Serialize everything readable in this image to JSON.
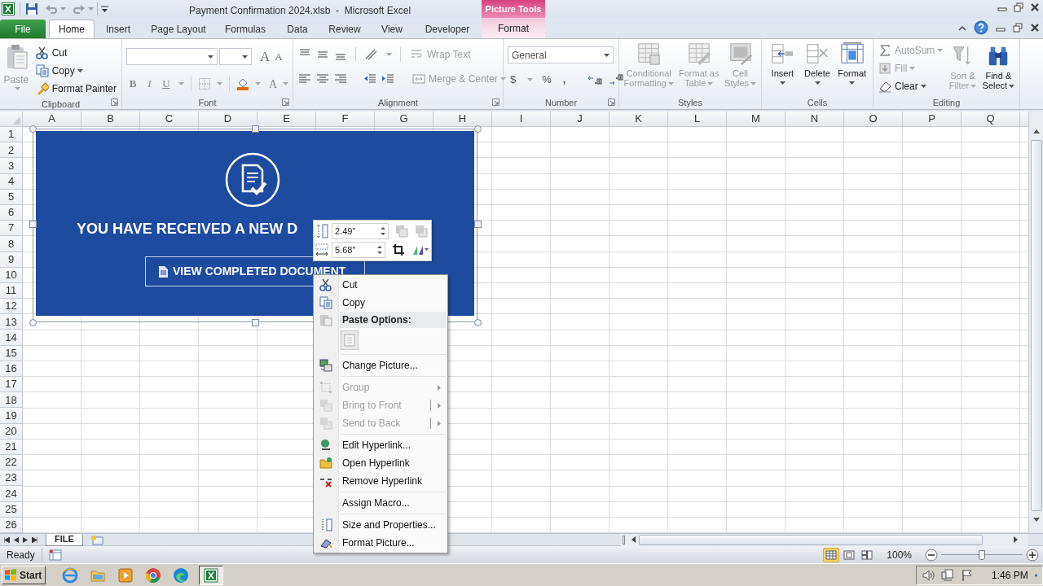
{
  "window": {
    "title": "Payment Confirmation 2024.xlsb  -  Microsoft Excel",
    "contextual_group": "Picture Tools"
  },
  "tabs": [
    {
      "label": "File",
      "kind": "file",
      "selected": false
    },
    {
      "label": "Home",
      "kind": "normal",
      "selected": true
    },
    {
      "label": "Insert",
      "kind": "normal",
      "selected": false
    },
    {
      "label": "Page Layout",
      "kind": "normal",
      "selected": false
    },
    {
      "label": "Formulas",
      "kind": "normal",
      "selected": false
    },
    {
      "label": "Data",
      "kind": "normal",
      "selected": false
    },
    {
      "label": "Review",
      "kind": "normal",
      "selected": false
    },
    {
      "label": "View",
      "kind": "normal",
      "selected": false
    },
    {
      "label": "Developer",
      "kind": "normal",
      "selected": false
    },
    {
      "label": "Format",
      "kind": "contextual",
      "selected": false
    }
  ],
  "ribbon": {
    "clipboard": {
      "label": "Clipboard",
      "paste": {
        "label": "Paste",
        "disabled": true
      },
      "cut": "Cut",
      "copy": "Copy",
      "format_painter": "Format Painter"
    },
    "font": {
      "label": "Font",
      "grow": "A",
      "shrink": "A",
      "bold": "B",
      "italic": "I",
      "underline": "U",
      "font_color_button": "A"
    },
    "alignment": {
      "label": "Alignment",
      "wrap_text": {
        "label": "Wrap Text",
        "disabled": true
      },
      "merge_center": {
        "label": "Merge & Center",
        "disabled": true
      }
    },
    "number": {
      "label": "Number",
      "format": "General",
      "currency": "$",
      "percent": "%",
      "comma": ","
    },
    "styles": {
      "label": "Styles",
      "buttons": [
        {
          "label": "Conditional Formatting",
          "disabled": true
        },
        {
          "label": "Format as Table",
          "disabled": true
        },
        {
          "label": "Cell Styles",
          "disabled": true
        }
      ]
    },
    "cells": {
      "label": "Cells",
      "buttons": [
        {
          "label": "Insert"
        },
        {
          "label": "Delete"
        },
        {
          "label": "Format"
        }
      ]
    },
    "editing": {
      "label": "Editing",
      "small": [
        {
          "label": "AutoSum",
          "disabled": true
        },
        {
          "label": "Fill",
          "disabled": true
        },
        {
          "label": "Clear",
          "disabled": false
        }
      ],
      "large": [
        {
          "label": "Sort & Filter",
          "disabled": true
        },
        {
          "label": "Find & Select",
          "disabled": false
        }
      ]
    }
  },
  "columns": [
    "A",
    "B",
    "C",
    "D",
    "E",
    "F",
    "G",
    "H",
    "I",
    "J",
    "K",
    "L",
    "M",
    "N",
    "O",
    "P",
    "Q"
  ],
  "rows": [
    "1",
    "2",
    "3",
    "4",
    "5",
    "6",
    "7",
    "8",
    "9",
    "10",
    "11",
    "12",
    "13",
    "14",
    "15",
    "16",
    "17",
    "18",
    "19",
    "20",
    "21",
    "22",
    "23",
    "24",
    "25",
    "26"
  ],
  "picture": {
    "heading": "YOU HAVE RECEIVED A NEW D",
    "button": "VIEW COMPLETED DOCUMENT"
  },
  "mini_toolbar": {
    "height": "2.49\"",
    "width": "5.68\""
  },
  "context_menu": [
    [
      {
        "label": "Cut",
        "kind": "command",
        "disabled": false,
        "submenu": false
      },
      {
        "label": "Copy",
        "kind": "command",
        "disabled": false,
        "submenu": false
      },
      {
        "label": "Paste Options:",
        "kind": "header"
      },
      {
        "kind": "paste-option"
      }
    ],
    [
      {
        "label": "Change Picture...",
        "kind": "command",
        "disabled": false,
        "submenu": false
      }
    ],
    [
      {
        "label": "Group",
        "kind": "command",
        "disabled": true,
        "submenu": true
      },
      {
        "label": "Bring to Front",
        "kind": "command",
        "disabled": true,
        "submenu": true
      },
      {
        "label": "Send to Back",
        "kind": "command",
        "disabled": true,
        "submenu": true
      }
    ],
    [
      {
        "label": "Edit Hyperlink...",
        "kind": "command",
        "disabled": false,
        "submenu": false
      },
      {
        "label": "Open Hyperlink",
        "kind": "command",
        "disabled": false,
        "submenu": false
      },
      {
        "label": "Remove Hyperlink",
        "kind": "command",
        "disabled": false,
        "submenu": false
      }
    ],
    [
      {
        "label": "Assign Macro...",
        "kind": "command",
        "disabled": false,
        "submenu": false
      }
    ],
    [
      {
        "label": "Size and Properties...",
        "kind": "command",
        "disabled": false,
        "submenu": false
      },
      {
        "label": "Format Picture...",
        "kind": "command",
        "disabled": false,
        "submenu": false
      }
    ]
  ],
  "sheet_tabs": [
    {
      "label": "FILE",
      "selected": true
    }
  ],
  "status_bar": {
    "mode": "Ready",
    "views": [
      {
        "selected": true
      },
      {
        "selected": false
      },
      {
        "selected": false
      }
    ],
    "zoom": {
      "label": "100%",
      "level": 0.5
    }
  },
  "taskbar": {
    "start": "Start",
    "apps": [
      {
        "selected": false
      },
      {
        "selected": false
      },
      {
        "selected": false
      },
      {
        "selected": false
      },
      {
        "selected": false
      },
      {
        "selected": true
      }
    ],
    "time": "1:46 PM"
  }
}
